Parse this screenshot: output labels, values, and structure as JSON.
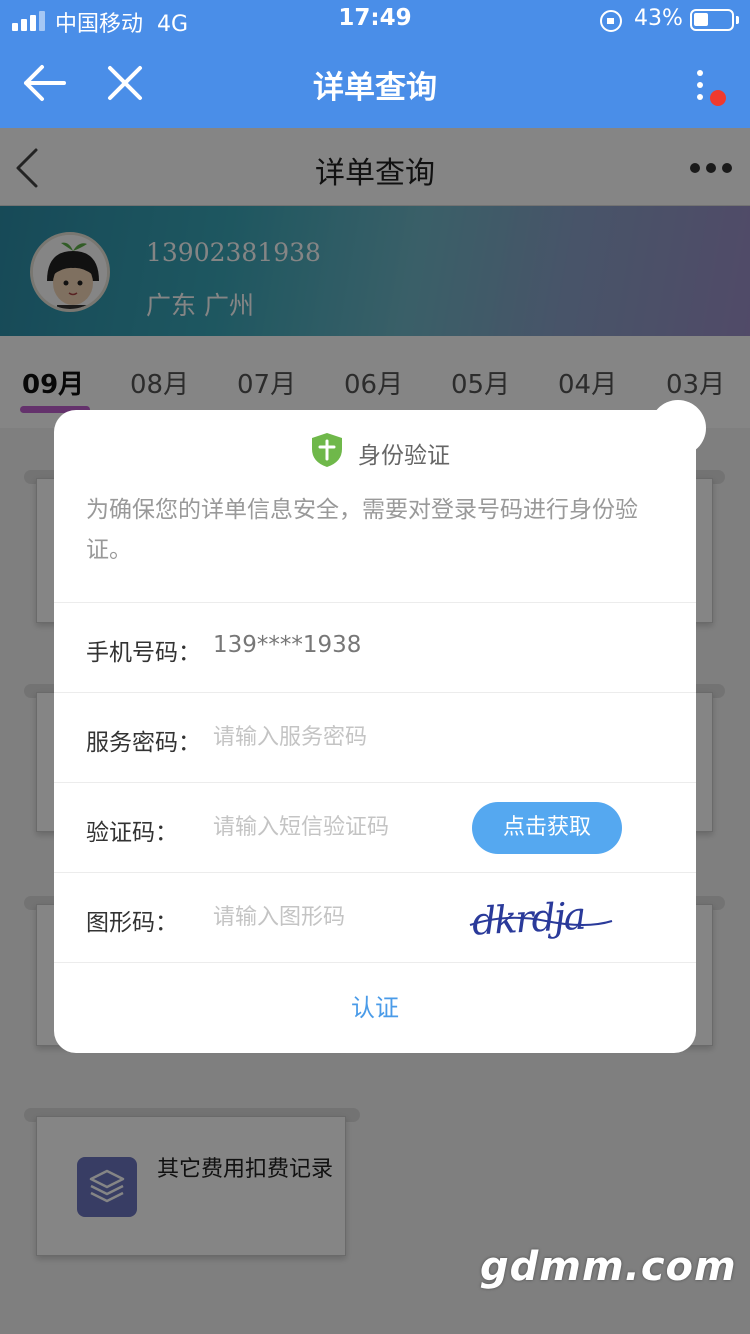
{
  "status_bar": {
    "carrier": "中国移动",
    "network": "4G",
    "time": "17:49",
    "battery_percent": "43%"
  },
  "app_bar": {
    "title": "详单查询"
  },
  "sub_header": {
    "title": "详单查询"
  },
  "profile": {
    "phone": "13902381938",
    "location": "广东 广州"
  },
  "months": {
    "active": "09月",
    "tabs": [
      "09月",
      "08月",
      "07月",
      "06月",
      "05月",
      "04月",
      "03月"
    ]
  },
  "cards": {
    "other_fees_label": "其它费用扣费记录"
  },
  "watermark": "gdmm.com",
  "modal": {
    "title": "身份验证",
    "description": "为确保您的详单信息安全，需要对登录号码进行身份验证。",
    "phone_label": "手机号码：",
    "phone_value": "139****1938",
    "service_pwd_label": "服务密码：",
    "service_pwd_placeholder": "请输入服务密码",
    "sms_code_label": "验证码：",
    "sms_code_placeholder": "请输入短信验证码",
    "get_code_button": "点击获取",
    "captcha_label": "图形码：",
    "captcha_placeholder": "请输入图形码",
    "captcha_text": "dkrdja",
    "submit_button": "认证"
  },
  "colors": {
    "brand_blue": "#4a8ee8",
    "button_blue": "#55a8f0",
    "shield_green": "#6fb84a",
    "tab_underline": "#c060d0",
    "notification_red": "#f03a2e"
  }
}
